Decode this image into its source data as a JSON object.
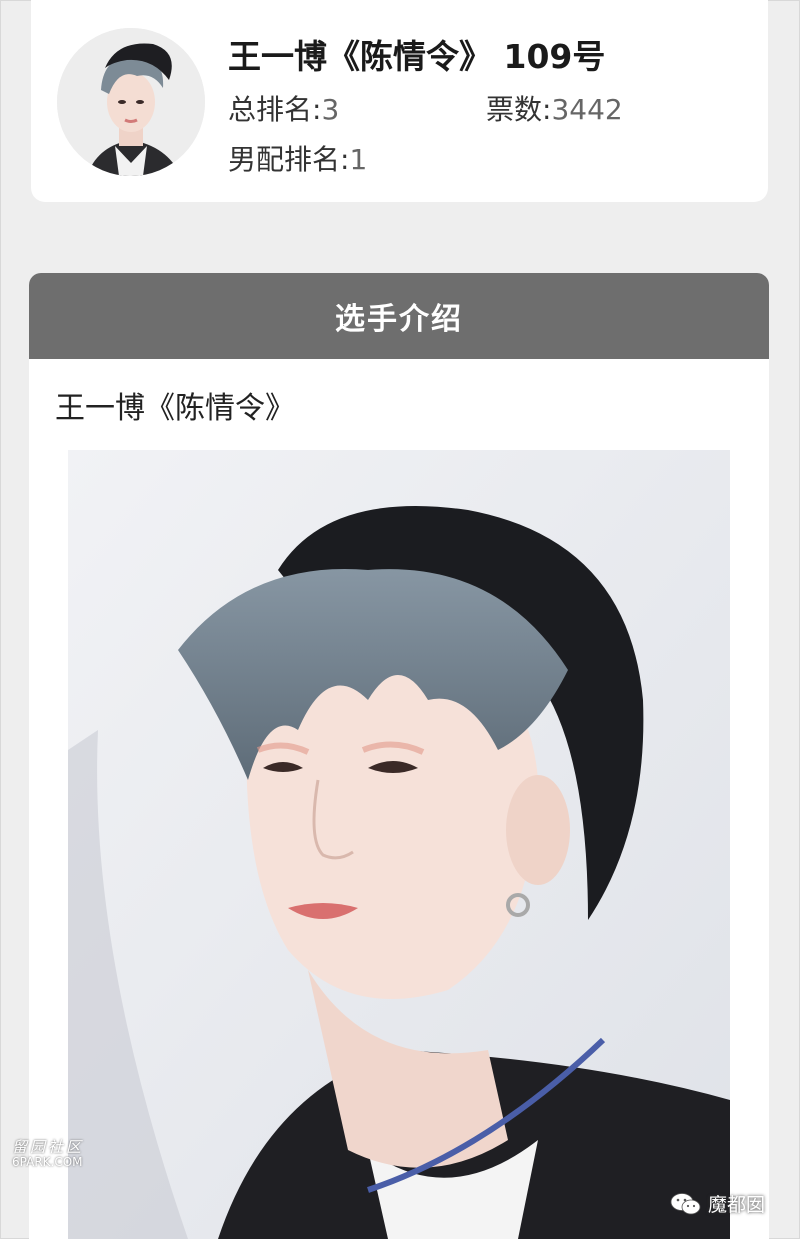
{
  "profile": {
    "title": "王一博《陈情令》 109号",
    "total_rank_label": "总排名:",
    "total_rank_value": "3",
    "votes_label": "票数:",
    "votes_value": "3442",
    "male_rank_label": "男配排名:",
    "male_rank_value": "1",
    "avatar_icon": "avatar-photo"
  },
  "intro": {
    "header": "选手介绍",
    "name": "王一博《陈情令》",
    "photo_icon": "portrait-photo"
  },
  "watermarks": {
    "left_cn": "留园社区",
    "left_en": "6PARK.COM",
    "right_text": "魔都囡",
    "right_icon": "wechat-icon"
  },
  "colors": {
    "header_bg": "#6e6e6e",
    "page_bg": "#eeeeee",
    "card_bg": "#ffffff"
  }
}
